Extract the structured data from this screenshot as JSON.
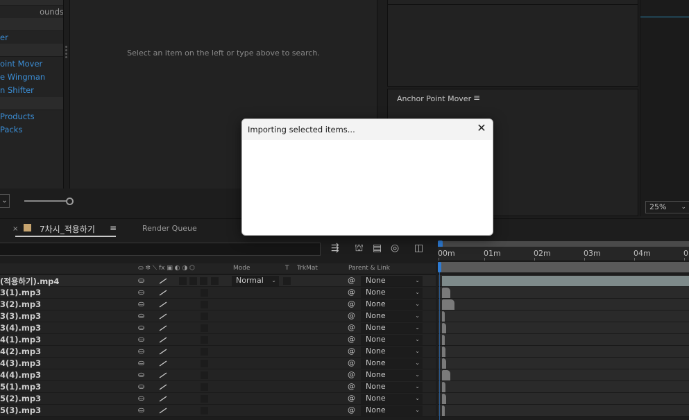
{
  "left_list": {
    "rows": [
      {
        "type": "cat",
        "label": ""
      },
      {
        "type": "plain",
        "label": "ounds"
      },
      {
        "type": "cat",
        "label": ""
      },
      {
        "type": "item",
        "label": "er"
      },
      {
        "type": "cat",
        "label": ""
      },
      {
        "type": "item",
        "label": "oint Mover"
      },
      {
        "type": "item",
        "label": "e Wingman"
      },
      {
        "type": "item",
        "label": "n Shifter"
      },
      {
        "type": "cat",
        "label": ""
      },
      {
        "type": "item",
        "label": "Products"
      },
      {
        "type": "item",
        "label": " Packs"
      }
    ]
  },
  "results": {
    "message": "Select an item on the left or type above to search."
  },
  "left_controls": {
    "dropdown_arrow": "⌄",
    "slider_value": 1.0
  },
  "anchor_panel": {
    "title": "Anchor Point Mover",
    "menu_icon": "hamburger-icon"
  },
  "viewer": {
    "zoom": "25%"
  },
  "timeline": {
    "close_glyph": "×",
    "comp_tab": "7차시_적용하기",
    "comp_color": "#c7a46f",
    "render_tab": "Render Queue",
    "columns": {
      "switches": "⛀ ✲ ⟍ fx ▣ ◐ ◑ ⬡",
      "mode": "Mode",
      "t": "T",
      "trkmat": "TrkMat",
      "parent": "Parent & Link"
    },
    "ruler_labels": [
      "00m",
      "01m",
      "02m",
      "03m",
      "04m",
      "0"
    ],
    "layers": [
      {
        "name": "(적용하기).mp4",
        "mode": "Normal",
        "parent": "None",
        "bar_end": 1.0
      },
      {
        "name": "3(1).mp3",
        "mode": "",
        "parent": "None",
        "bar_end": 0.035
      },
      {
        "name": "3(2).mp3",
        "mode": "",
        "parent": "None",
        "bar_end": 0.05
      },
      {
        "name": "3(3).mp3",
        "mode": "",
        "parent": "None",
        "bar_end": 0.012
      },
      {
        "name": "3(4).mp3",
        "mode": "",
        "parent": "None",
        "bar_end": 0.018
      },
      {
        "name": "4(1).mp3",
        "mode": "",
        "parent": "None",
        "bar_end": 0.01
      },
      {
        "name": "4(2).mp3",
        "mode": "",
        "parent": "None",
        "bar_end": 0.015
      },
      {
        "name": "4(3).mp3",
        "mode": "",
        "parent": "None",
        "bar_end": 0.018
      },
      {
        "name": "4(4).mp3",
        "mode": "",
        "parent": "None",
        "bar_end": 0.035
      },
      {
        "name": "5(1).mp3",
        "mode": "",
        "parent": "None",
        "bar_end": 0.015
      },
      {
        "name": "5(2).mp3",
        "mode": "",
        "parent": "None",
        "bar_end": 0.018
      },
      {
        "name": "5(3).mp3",
        "mode": "",
        "parent": "None",
        "bar_end": 0.012
      }
    ]
  },
  "dialog": {
    "title": "Importing selected items...",
    "close_glyph": "✕"
  }
}
